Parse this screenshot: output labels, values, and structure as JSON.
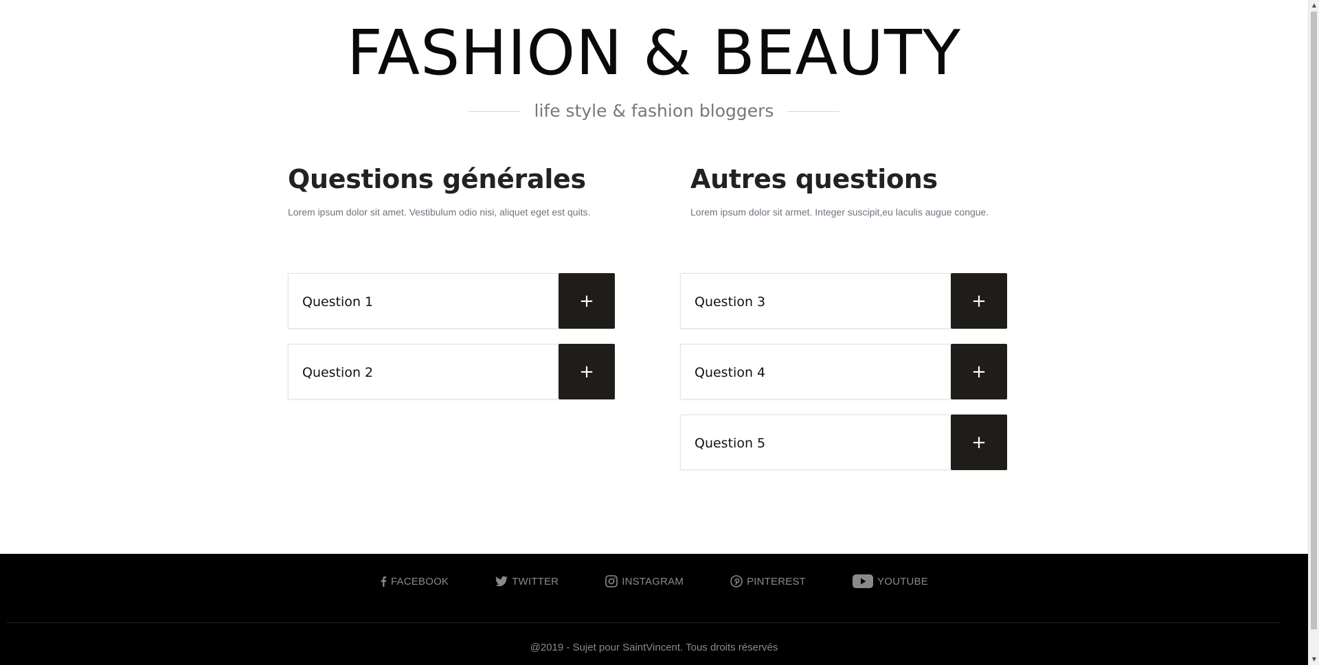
{
  "header": {
    "title": "FASHION & BEAUTY",
    "tagline": "life style & fashion bloggers"
  },
  "sections": [
    {
      "title": "Questions générales",
      "description": "Lorem ipsum dolor sit amet. Vestibulum odio nisi, aliquet eget est quits.",
      "questions": [
        "Question 1",
        "Question 2"
      ]
    },
    {
      "title": "Autres questions",
      "description": "Lorem ipsum dolor sit armet. Integer suscipit,eu laculis augue congue.",
      "questions": [
        "Question 3",
        "Question 4",
        "Question 5"
      ]
    }
  ],
  "toggle_symbol": "+",
  "footer": {
    "social": [
      {
        "label": "FACEBOOK",
        "icon": "facebook-icon"
      },
      {
        "label": "TWITTER",
        "icon": "twitter-icon"
      },
      {
        "label": "INSTAGRAM",
        "icon": "instagram-icon"
      },
      {
        "label": "PINTEREST",
        "icon": "pinterest-icon"
      },
      {
        "label": "YOUTUBE",
        "icon": "youtube-icon"
      }
    ],
    "copyright": "@2019 - Sujet pour SaintVincent. Tous droits réservés"
  },
  "colors": {
    "accent_button": "#1f1d19",
    "footer_bg": "#000000",
    "footer_text": "#8a8a8a",
    "tagline": "#777777"
  }
}
